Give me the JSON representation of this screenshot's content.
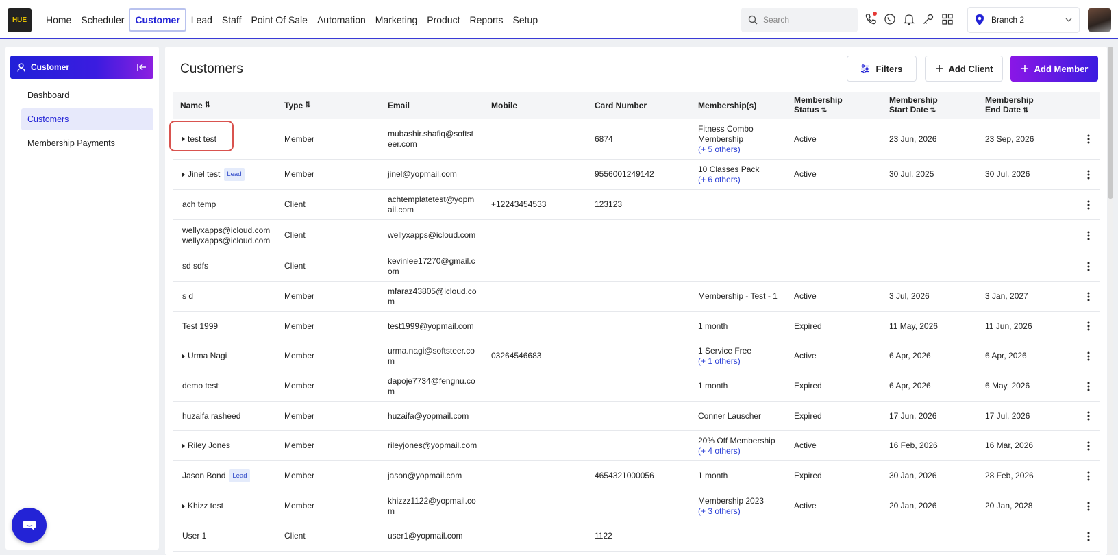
{
  "nav": {
    "logo_text": "HUE",
    "items": [
      "Home",
      "Scheduler",
      "Customer",
      "Lead",
      "Staff",
      "Point Of Sale",
      "Automation",
      "Marketing",
      "Product",
      "Reports",
      "Setup"
    ],
    "active": "Customer",
    "search_placeholder": "Search",
    "branch": "Branch 2",
    "icons": [
      "phone-icon",
      "whatsapp-icon",
      "bell-icon",
      "key-icon",
      "grid-icon"
    ]
  },
  "sidebar": {
    "header": "Customer",
    "items": [
      "Dashboard",
      "Customers",
      "Membership Payments"
    ],
    "active": "Customers"
  },
  "page": {
    "title": "Customers",
    "filters_label": "Filters",
    "add_client_label": "Add Client",
    "add_member_label": "Add Member"
  },
  "table": {
    "headers": {
      "name": "Name",
      "type": "Type",
      "email": "Email",
      "mobile": "Mobile",
      "card": "Card Number",
      "memberships": "Membership(s)",
      "status_1": "Membership",
      "status_2": "Status",
      "start_1": "Membership",
      "start_2": "Start Date",
      "end_1": "Membership",
      "end_2": "End Date"
    },
    "rows": [
      {
        "name": "test test",
        "caret": true,
        "lead": "",
        "type": "Member",
        "email": "mubashir.shafiq@softst\neer.com",
        "mobile": "",
        "card": "6874",
        "membership": "Fitness Combo\nMembership",
        "others": "(+ 5 others)",
        "status": "Active",
        "start": "23 Jun, 2026",
        "end": "23 Sep, 2026",
        "h": 59
      },
      {
        "name": "Jinel test",
        "caret": true,
        "lead": "Lead",
        "type": "Member",
        "email": "jinel@yopmail.com",
        "mobile": "",
        "card": "9556001249142",
        "membership": "10 Classes Pack",
        "others": "(+ 6 others)",
        "status": "Active",
        "start": "30 Jul, 2025",
        "end": "30 Jul, 2026",
        "h": 44
      },
      {
        "name": "ach temp",
        "caret": false,
        "lead": "",
        "type": "Client",
        "email": "achtemplatetest@yopm\nail.com",
        "mobile": "+12243454533",
        "card": "123123",
        "membership": "",
        "others": "",
        "status": "",
        "start": "",
        "end": "",
        "h": 44
      },
      {
        "name": "wellyxapps@icloud.com\nwellyxapps@icloud.com",
        "caret": false,
        "lead": "",
        "type": "Client",
        "email": "wellyxapps@icloud.com",
        "mobile": "",
        "card": "",
        "membership": "",
        "others": "",
        "status": "",
        "start": "",
        "end": "",
        "h": 46
      },
      {
        "name": "sd sdfs",
        "caret": false,
        "lead": "",
        "type": "Client",
        "email": "kevinlee17270@gmail.c\nom",
        "mobile": "",
        "card": "",
        "membership": "",
        "others": "",
        "status": "",
        "start": "",
        "end": "",
        "h": 44
      },
      {
        "name": "s d",
        "caret": false,
        "lead": "",
        "type": "Member",
        "email": "mfaraz43805@icloud.co\nm",
        "mobile": "",
        "card": "",
        "membership": "Membership - Test - 1",
        "others": "",
        "status": "Active",
        "start": "3 Jul, 2026",
        "end": "3 Jan, 2027",
        "h": 44
      },
      {
        "name": "Test 1999",
        "caret": false,
        "lead": "",
        "type": "Member",
        "email": "test1999@yopmail.com",
        "mobile": "",
        "card": "",
        "membership": "1 month",
        "others": "",
        "status": "Expired",
        "start": "11 May, 2026",
        "end": "11 Jun, 2026",
        "h": 43
      },
      {
        "name": "Urma Nagi",
        "caret": true,
        "lead": "",
        "type": "Member",
        "email": "urma.nagi@softsteer.co\nm",
        "mobile": "03264546683",
        "card": "",
        "membership": "1 Service Free",
        "others": "(+ 1 others)",
        "status": "Active",
        "start": "6 Apr, 2026",
        "end": "6 Apr, 2026",
        "h": 44
      },
      {
        "name": "demo test",
        "caret": false,
        "lead": "",
        "type": "Member",
        "email": "dapoje7734@fengnu.co\nm",
        "mobile": "",
        "card": "",
        "membership": "1 month",
        "others": "",
        "status": "Expired",
        "start": "6 Apr, 2026",
        "end": "6 May, 2026",
        "h": 44
      },
      {
        "name": "huzaifa rasheed",
        "caret": false,
        "lead": "",
        "type": "Member",
        "email": "huzaifa@yopmail.com",
        "mobile": "",
        "card": "",
        "membership": "Conner Lauscher",
        "others": "",
        "status": "Expired",
        "start": "17 Jun, 2026",
        "end": "17 Jul, 2026",
        "h": 43
      },
      {
        "name": "Riley Jones",
        "caret": true,
        "lead": "",
        "type": "Member",
        "email": "rileyjones@yopmail.com",
        "mobile": "",
        "card": "",
        "membership": "20% Off Membership",
        "others": "(+ 4 others)",
        "status": "Active",
        "start": "16 Feb, 2026",
        "end": "16 Mar, 2026",
        "h": 44
      },
      {
        "name": "Jason Bond",
        "caret": false,
        "lead": "Lead",
        "type": "Member",
        "email": "jason@yopmail.com",
        "mobile": "",
        "card": "4654321000056",
        "membership": "1 month",
        "others": "",
        "status": "Expired",
        "start": "30 Jan, 2026",
        "end": "28 Feb, 2026",
        "h": 44
      },
      {
        "name": "Khizz test",
        "caret": true,
        "lead": "",
        "type": "Member",
        "email": "khizzz1122@yopmail.co\nm",
        "mobile": "",
        "card": "",
        "membership": "Membership 2023",
        "others": "(+ 3 others)",
        "status": "Active",
        "start": "20 Jan, 2026",
        "end": "20 Jan, 2028",
        "h": 44
      },
      {
        "name": "User 1",
        "caret": false,
        "lead": "",
        "type": "Client",
        "email": "user1@yopmail.com",
        "mobile": "",
        "card": "1122",
        "membership": "",
        "others": "",
        "status": "",
        "start": "",
        "end": "",
        "h": 44
      }
    ]
  }
}
